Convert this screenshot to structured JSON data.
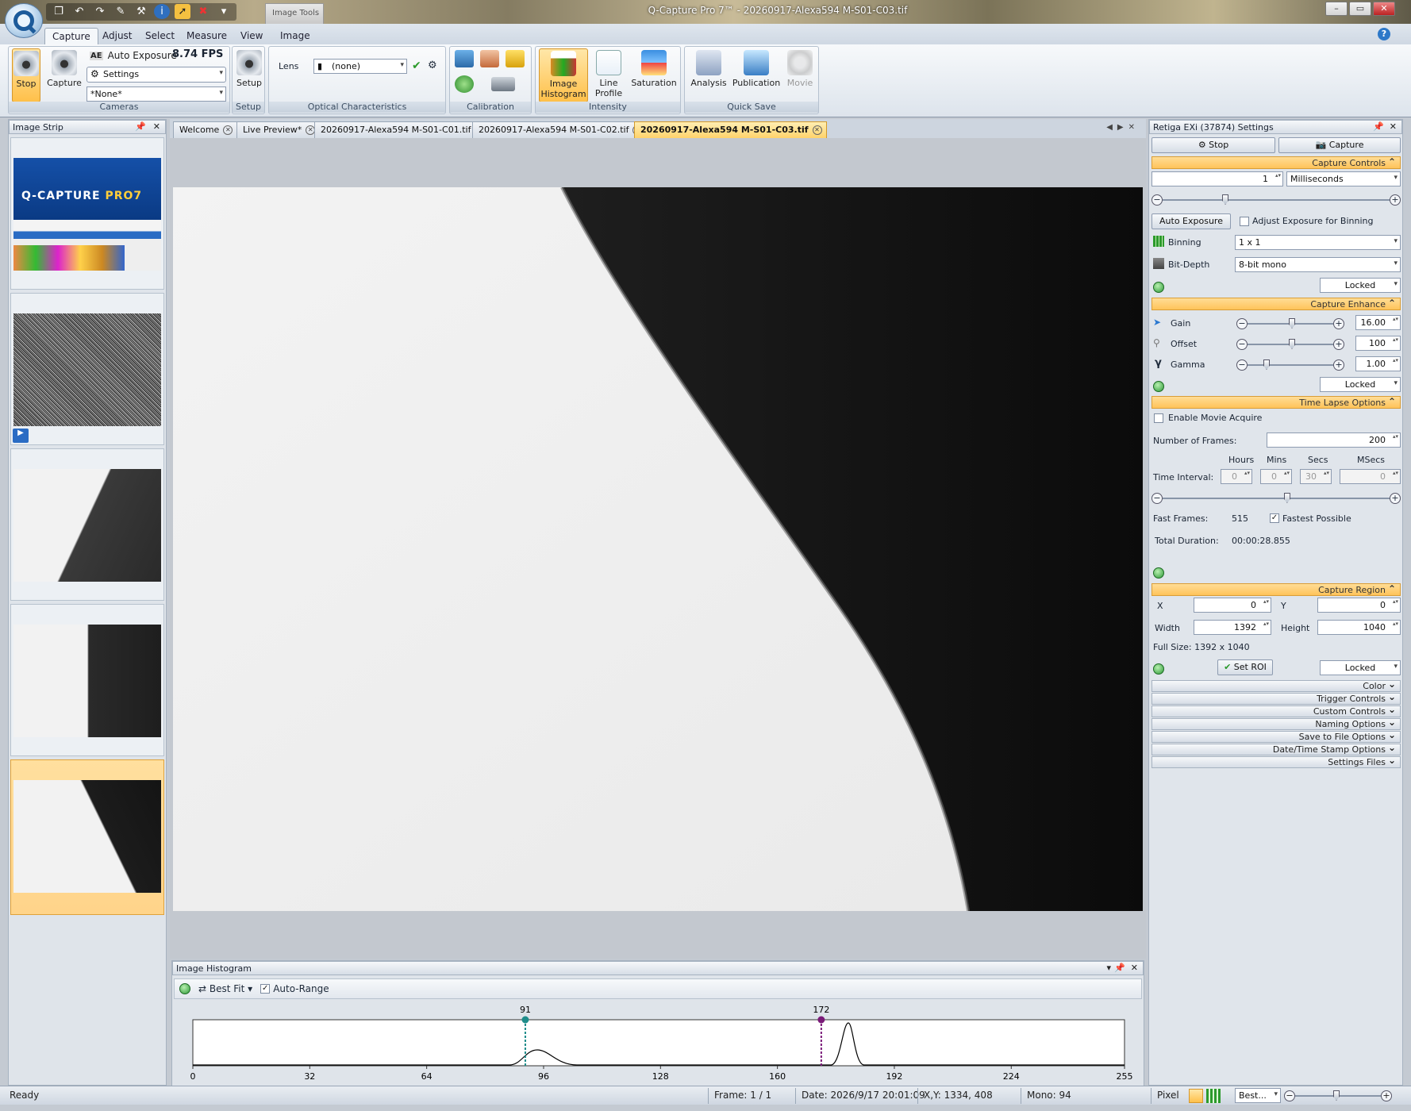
{
  "window": {
    "title": "Q-Capture Pro 7™ - 20260917-Alexa594 M-S01-C03.tif",
    "context_tab": "Image Tools"
  },
  "ribbon": {
    "tabs": [
      "Capture",
      "Adjust",
      "Select",
      "Measure",
      "View",
      "Image"
    ],
    "active_tab": "Capture",
    "cameras": {
      "stop_label": "Stop",
      "capture_label": "Capture",
      "auto_exposure_label": "Auto Exposure",
      "fps": "8.74 FPS",
      "settings_label": "Settings",
      "none_label": "*None*",
      "group_label": "Cameras"
    },
    "setup": {
      "setup_label": "Setup",
      "group_label": "Setup"
    },
    "optical": {
      "lens_label": "Lens",
      "lens_value": "(none)",
      "group_label": "Optical Characteristics"
    },
    "calibration": {
      "group_label": "Calibration"
    },
    "intensity": {
      "image_histogram_label_1": "Image",
      "image_histogram_label_2": "Histogram",
      "line_profile_label_1": "Line",
      "line_profile_label_2": "Profile",
      "saturation_label": "Saturation",
      "group_label": "Intensity"
    },
    "quicksave": {
      "analysis_label": "Analysis",
      "publication_label": "Publication",
      "movie_label": "Movie",
      "group_label": "Quick Save"
    }
  },
  "image_strip": {
    "title": "Image Strip"
  },
  "doc_tabs": [
    {
      "label": "Welcome"
    },
    {
      "label": "Live Preview*"
    },
    {
      "label": "20260917-Alexa594 M-S01-C01.tif"
    },
    {
      "label": "20260917-Alexa594 M-S01-C02.tif"
    },
    {
      "label": "20260917-Alexa594 M-S01-C03.tif"
    }
  ],
  "histogram": {
    "title": "Image Histogram",
    "fit_label": "Best Fit",
    "auto_range_label": "Auto-Range",
    "low_marker": "91",
    "high_marker": "172",
    "ticks": [
      "0",
      "32",
      "64",
      "96",
      "128",
      "160",
      "192",
      "224",
      "255"
    ],
    "colors": {
      "low": "#1e8c8a",
      "high": "#7a1a78"
    }
  },
  "settings": {
    "title": "Retiga EXi (37874) Settings",
    "stop_label": "Stop",
    "capture_label": "Capture",
    "capture_controls": {
      "title": "Capture Controls",
      "exposure_value": "1",
      "exposure_unit": "Milliseconds",
      "exposure_slider": 0.27,
      "auto_exposure_label": "Auto Exposure",
      "adjust_binning_label": "Adjust Exposure for Binning",
      "binning_label": "Binning",
      "binning_value": "1 x 1",
      "bitdepth_label": "Bit-Depth",
      "bitdepth_value": "8-bit mono",
      "locked_label": "Locked"
    },
    "capture_enhance": {
      "title": "Capture Enhance",
      "gain_label": "Gain",
      "gain_value": "16.00",
      "gain_slider": 0.52,
      "offset_label": "Offset",
      "offset_value": "100",
      "offset_slider": 0.52,
      "gamma_label": "Gamma",
      "gamma_value": "1.00",
      "gamma_slider": 0.2,
      "locked_label": "Locked"
    },
    "time_lapse": {
      "title": "Time Lapse Options",
      "enable_movie_label": "Enable Movie Acquire",
      "frames_label": "Number of  Frames:",
      "frames_value": "200",
      "hours_label": "Hours",
      "mins_label": "Mins",
      "secs_label": "Secs",
      "msecs_label": "MSecs",
      "interval_label": "Time Interval:",
      "hours_value": "0",
      "mins_value": "0",
      "secs_value": "30",
      "msecs_value": "0",
      "interval_slider": 0.55,
      "fast_frames_label": "Fast Frames:",
      "fast_frames_value": "515",
      "fastest_label": "Fastest Possible",
      "duration_label": "Total Duration:",
      "duration_value": "00:00:28.855"
    },
    "capture_region": {
      "title": "Capture Region",
      "x_label": "X",
      "x_value": "0",
      "y_label": "Y",
      "y_value": "0",
      "width_label": "Width",
      "width_value": "1392",
      "height_label": "Height",
      "height_value": "1040",
      "full_size": "Full Size: 1392 x 1040",
      "set_roi_label": "Set ROI",
      "locked_label": "Locked"
    },
    "collapsed_sections": [
      "Color",
      "Trigger Controls",
      "Custom Controls",
      "Naming Options",
      "Save to File Options",
      "Date/Time Stamp Options",
      "Settings Files"
    ]
  },
  "status": {
    "ready": "Ready",
    "frame": "Frame: 1 / 1",
    "date": "Date: 2026/9/17 20:01:09",
    "xy": "X,Y: 1334,  408",
    "mono": "Mono:   94",
    "pixel": "Pixel",
    "zoom_label": "Best..."
  }
}
